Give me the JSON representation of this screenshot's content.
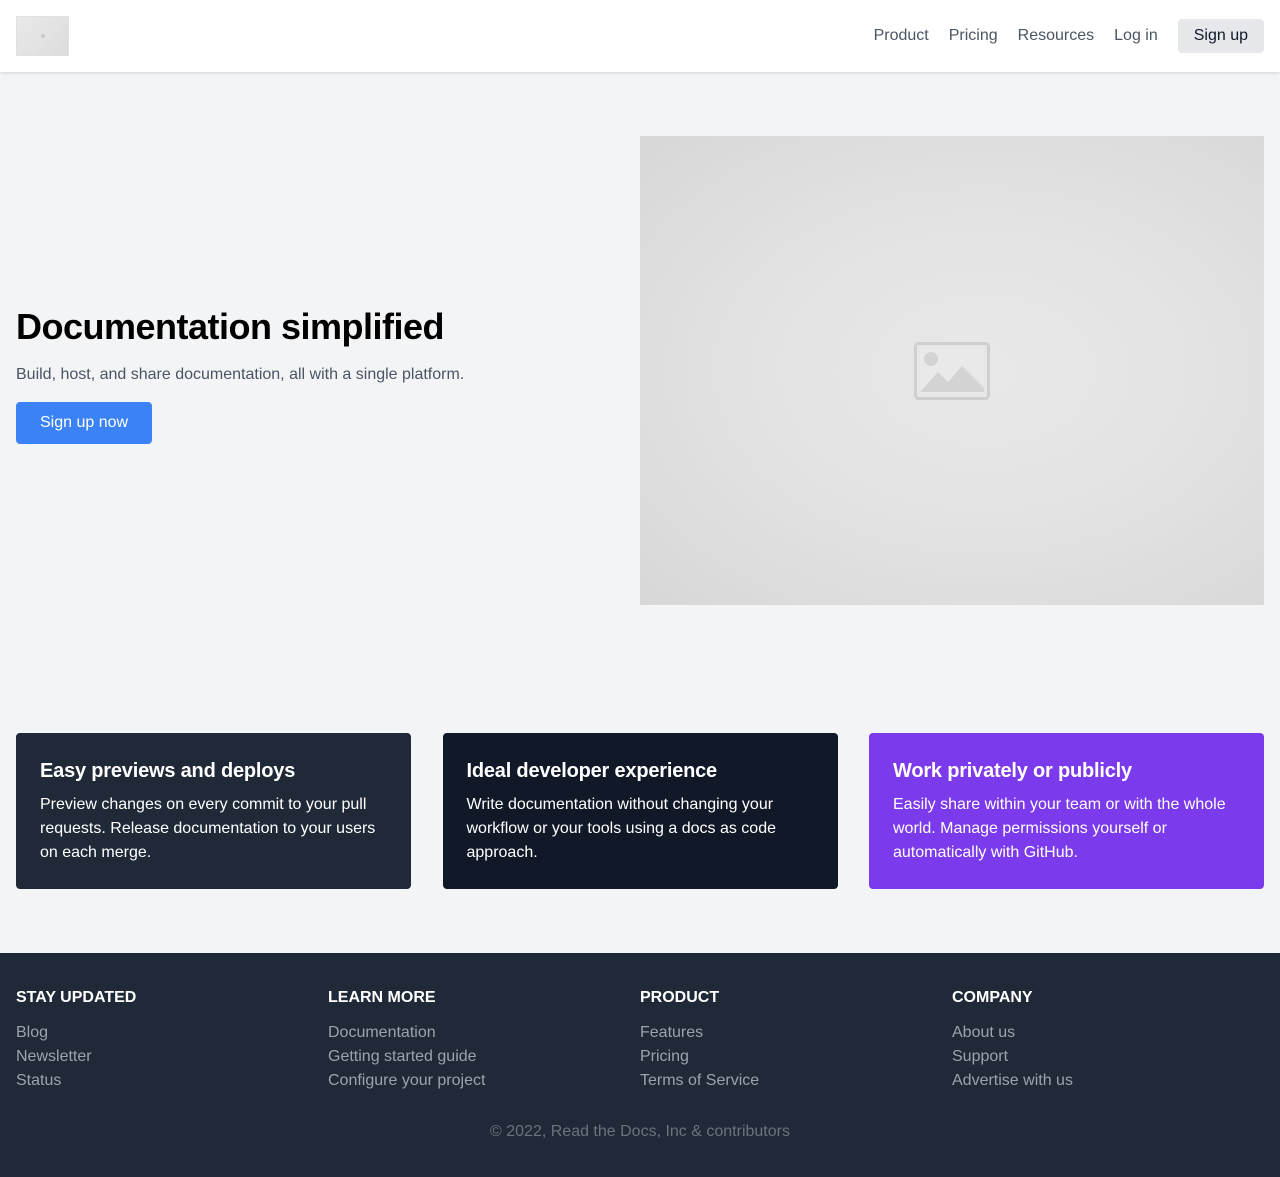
{
  "header": {
    "logo_icon": "image-placeholder-icon",
    "nav": [
      {
        "label": "Product"
      },
      {
        "label": "Pricing"
      },
      {
        "label": "Resources"
      },
      {
        "label": "Log in"
      }
    ],
    "signup_label": "Sign up"
  },
  "hero": {
    "title": "Documentation simplified",
    "subtitle": "Build, host, and share documentation, all with a single platform.",
    "cta_label": "Sign up now",
    "image_icon": "image-placeholder-icon"
  },
  "features": [
    {
      "title": "Easy previews and deploys",
      "text": "Preview changes on every commit to your pull requests. Release documentation to your users on each merge.",
      "color": "#1f2937"
    },
    {
      "title": "Ideal developer experience",
      "text": "Write documentation without changing your workflow or your tools using a docs as code approach.",
      "color": "#111827"
    },
    {
      "title": "Work privately or publicly",
      "text": "Easily share within your team or with the whole world. Manage permissions yourself or automatically with GitHub.",
      "color": "#7c3aed"
    }
  ],
  "footer": {
    "columns": [
      {
        "heading": "STAY UPDATED",
        "links": [
          "Blog",
          "Newsletter",
          "Status"
        ]
      },
      {
        "heading": "LEARN MORE",
        "links": [
          "Documentation",
          "Getting started guide",
          "Configure your project"
        ]
      },
      {
        "heading": "PRODUCT",
        "links": [
          "Features",
          "Pricing",
          "Terms of Service"
        ]
      },
      {
        "heading": "COMPANY",
        "links": [
          "About us",
          "Support",
          "Advertise with us"
        ]
      }
    ],
    "copyright": "© 2022, Read the Docs, Inc & contributors"
  },
  "colors": {
    "accent": "#3b82f6",
    "background": "#f3f4f6",
    "footer_bg": "#1f2937"
  }
}
